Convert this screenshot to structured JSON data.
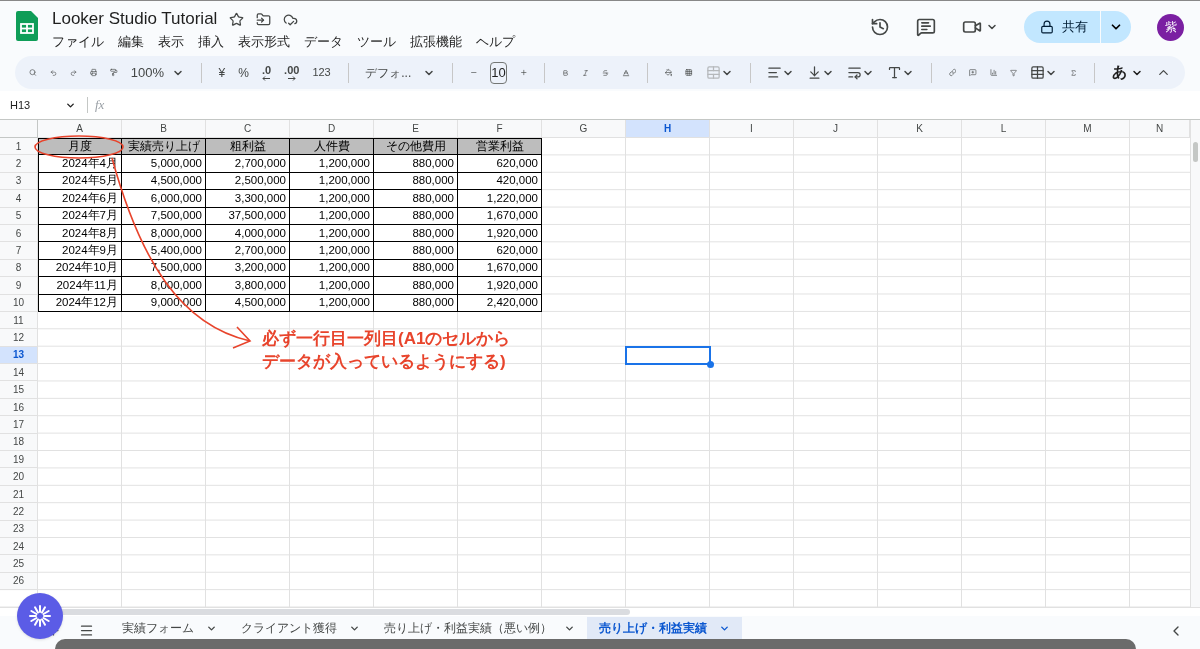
{
  "document": {
    "title": "Looker Studio Tutorial",
    "menu": [
      "ファイル",
      "編集",
      "表示",
      "挿入",
      "表示形式",
      "データ",
      "ツール",
      "拡張機能",
      "ヘルプ"
    ],
    "share_label": "共有",
    "avatar": "紫"
  },
  "toolbar": {
    "zoom": "100%",
    "currency": "¥",
    "percent": "%",
    "decimal_decrease": ".0",
    "decimal_increase": ".00",
    "number_format": "123",
    "font": "デフォ...",
    "font_size": "10",
    "input_mode": "あ"
  },
  "formula_bar": {
    "name_box": "H13",
    "fx": "fx"
  },
  "columns": [
    {
      "label": "A",
      "selected": false
    },
    {
      "label": "B",
      "selected": false
    },
    {
      "label": "C",
      "selected": false
    },
    {
      "label": "D",
      "selected": false
    },
    {
      "label": "E",
      "selected": false
    },
    {
      "label": "F",
      "selected": false
    },
    {
      "label": "G",
      "selected": false
    },
    {
      "label": "H",
      "selected": true
    },
    {
      "label": "I",
      "selected": false
    },
    {
      "label": "J",
      "selected": false
    },
    {
      "label": "K",
      "selected": false
    },
    {
      "label": "L",
      "selected": false
    },
    {
      "label": "M",
      "selected": false
    },
    {
      "label": "N",
      "selected": false
    }
  ],
  "row_numbers": [
    {
      "label": "1",
      "selected": false
    },
    {
      "label": "2",
      "selected": false
    },
    {
      "label": "3",
      "selected": false
    },
    {
      "label": "4",
      "selected": false
    },
    {
      "label": "5",
      "selected": false
    },
    {
      "label": "6",
      "selected": false
    },
    {
      "label": "7",
      "selected": false
    },
    {
      "label": "8",
      "selected": false
    },
    {
      "label": "9",
      "selected": false
    },
    {
      "label": "10",
      "selected": false
    },
    {
      "label": "11",
      "selected": false
    },
    {
      "label": "12",
      "selected": false
    },
    {
      "label": "13",
      "selected": true
    },
    {
      "label": "14",
      "selected": false
    },
    {
      "label": "15",
      "selected": false
    },
    {
      "label": "16",
      "selected": false
    },
    {
      "label": "17",
      "selected": false
    },
    {
      "label": "18",
      "selected": false
    },
    {
      "label": "19",
      "selected": false
    },
    {
      "label": "20",
      "selected": false
    },
    {
      "label": "21",
      "selected": false
    },
    {
      "label": "22",
      "selected": false
    },
    {
      "label": "23",
      "selected": false
    },
    {
      "label": "24",
      "selected": false
    },
    {
      "label": "25",
      "selected": false
    },
    {
      "label": "26",
      "selected": false
    }
  ],
  "table": {
    "header": [
      "月度",
      "実績売り上げ",
      "粗利益",
      "人件費",
      "その他費用",
      "営業利益"
    ],
    "rows": [
      [
        "2024年4月",
        "5,000,000",
        "2,700,000",
        "1,200,000",
        "880,000",
        "620,000"
      ],
      [
        "2024年5月",
        "4,500,000",
        "2,500,000",
        "1,200,000",
        "880,000",
        "420,000"
      ],
      [
        "2024年6月",
        "6,000,000",
        "3,300,000",
        "1,200,000",
        "880,000",
        "1,220,000"
      ],
      [
        "2024年7月",
        "7,500,000",
        "37,500,000",
        "1,200,000",
        "880,000",
        "1,670,000"
      ],
      [
        "2024年8月",
        "8,000,000",
        "4,000,000",
        "1,200,000",
        "880,000",
        "1,920,000"
      ],
      [
        "2024年9月",
        "5,400,000",
        "2,700,000",
        "1,200,000",
        "880,000",
        "620,000"
      ],
      [
        "2024年10月",
        "7,500,000",
        "3,200,000",
        "1,200,000",
        "880,000",
        "1,670,000"
      ],
      [
        "2024年11月",
        "8,000,000",
        "3,800,000",
        "1,200,000",
        "880,000",
        "1,920,000"
      ],
      [
        "2024年12月",
        "9,000,000",
        "4,500,000",
        "1,200,000",
        "880,000",
        "2,420,000"
      ]
    ]
  },
  "annotation": {
    "lines": [
      "必ず一行目一列目(A1のセルから",
      "データが入っているようにする)"
    ]
  },
  "sheets": [
    {
      "label": "実績フォーム",
      "selected": false
    },
    {
      "label": "クライアント獲得",
      "selected": false
    },
    {
      "label": "売り上げ・利益実績（悪い例）",
      "selected": false
    },
    {
      "label": "売り上げ・利益実績",
      "selected": true
    }
  ]
}
